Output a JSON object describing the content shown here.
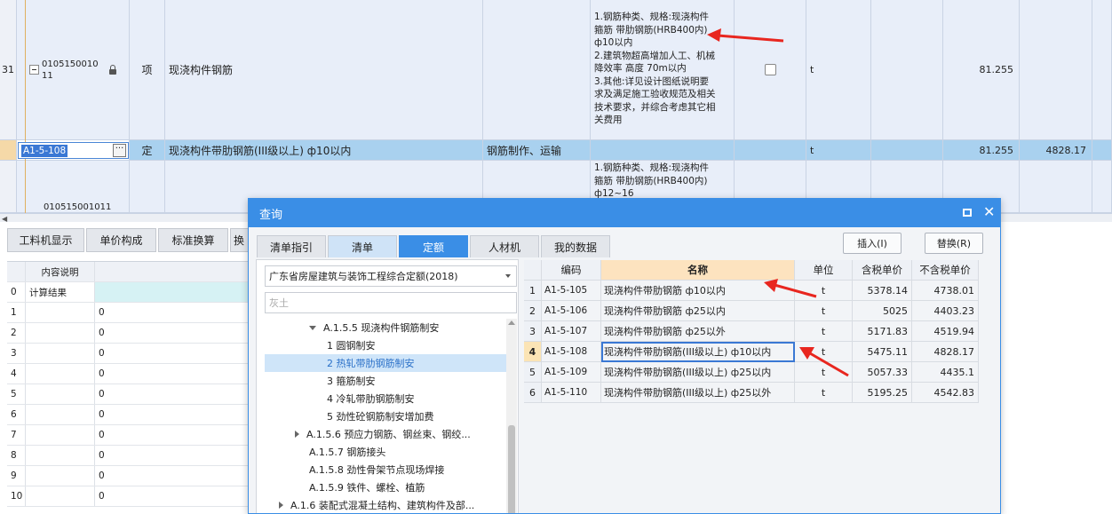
{
  "top_grid": {
    "row31": {
      "index": "31",
      "code": "010515001011",
      "type": "项",
      "name": "现浇构件钢筋",
      "features": "1.钢筋种类、规格:现浇构件\n箍筋 带肋钢筋(HRB400内)\nф10以内\n2.建筑物超高增加人工、机械\n降效率 高度 70m以内\n3.其他:详见设计图纸说明要\n求及满足施工验收规范及相关\n技术要求，并综合考虑其它相\n关费用",
      "unit": "t",
      "quantity": "81.255"
    },
    "row_sub": {
      "code": "A1-5-108",
      "type": "定",
      "name": "现浇构件带肋钢筋(III级以上) ф10以内",
      "work": "钢筋制作、运输",
      "unit": "t",
      "quantity": "81.255",
      "price": "4828.17"
    },
    "row_next": {
      "code": "010515001011",
      "features": "1.钢筋种类、规格:现浇构件\n箍筋 带肋钢筋(HRB400内)\nф12~16"
    }
  },
  "bottom_tabs": [
    "工料机显示",
    "单价构成",
    "标准换算",
    "换"
  ],
  "bottom_grid": {
    "header": "内容说明",
    "rows": [
      {
        "n": "0",
        "label": "计算结果",
        "value": ""
      },
      {
        "n": "1",
        "label": "",
        "value": "0"
      },
      {
        "n": "2",
        "label": "",
        "value": "0"
      },
      {
        "n": "3",
        "label": "",
        "value": "0"
      },
      {
        "n": "4",
        "label": "",
        "value": "0"
      },
      {
        "n": "5",
        "label": "",
        "value": "0"
      },
      {
        "n": "6",
        "label": "",
        "value": "0"
      },
      {
        "n": "7",
        "label": "",
        "value": "0"
      },
      {
        "n": "8",
        "label": "",
        "value": "0"
      },
      {
        "n": "9",
        "label": "",
        "value": "0"
      },
      {
        "n": "10",
        "label": "",
        "value": "0"
      }
    ]
  },
  "dialog": {
    "title": "查询",
    "tabs": [
      "清单指引",
      "清单",
      "定额",
      "人材机",
      "我的数据"
    ],
    "active_tab": "定额",
    "insert_label": "插入(I)",
    "replace_label": "替换(R)",
    "quota_library": "广东省房屋建筑与装饰工程综合定额(2018)",
    "search_placeholder": "灰土",
    "tree": [
      {
        "label": "A.1.5.5 现浇构件钢筋制安",
        "expanded": true
      },
      {
        "label": "1 圆钢制安"
      },
      {
        "label": "2 热轧带肋钢筋制安",
        "selected": true
      },
      {
        "label": "3 箍筋制安"
      },
      {
        "label": "4 冷轧带肋钢筋制安"
      },
      {
        "label": "5 劲性砼钢筋制安增加费"
      },
      {
        "label": "A.1.5.6 预应力钢筋、钢丝束、钢绞...",
        "expanded": false
      },
      {
        "label": "A.1.5.7 钢筋接头"
      },
      {
        "label": "A.1.5.8 劲性骨架节点现场焊接"
      },
      {
        "label": "A.1.5.9 铁件、螺栓、植筋"
      },
      {
        "label": "A.1.6 装配式混凝土结构、建筑构件及部...",
        "expanded": false
      }
    ],
    "table": {
      "headers": [
        "",
        "编码",
        "名称",
        "单位",
        "含税单价",
        "不含税单价"
      ],
      "rows": [
        {
          "n": "1",
          "code": "A1-5-105",
          "name": "现浇构件带肋钢筋 ф10以内",
          "unit": "t",
          "tax_price": "5378.14",
          "notax_price": "4738.01"
        },
        {
          "n": "2",
          "code": "A1-5-106",
          "name": "现浇构件带肋钢筋 ф25以内",
          "unit": "t",
          "tax_price": "5025",
          "notax_price": "4403.23"
        },
        {
          "n": "3",
          "code": "A1-5-107",
          "name": "现浇构件带肋钢筋 ф25以外",
          "unit": "t",
          "tax_price": "5171.83",
          "notax_price": "4519.94"
        },
        {
          "n": "4",
          "code": "A1-5-108",
          "name": "现浇构件带肋钢筋(III级以上) ф10以内",
          "unit": "t",
          "tax_price": "5475.11",
          "notax_price": "4828.17"
        },
        {
          "n": "5",
          "code": "A1-5-109",
          "name": "现浇构件带肋钢筋(III级以上) ф25以内",
          "unit": "t",
          "tax_price": "5057.33",
          "notax_price": "4435.1"
        },
        {
          "n": "6",
          "code": "A1-5-110",
          "name": "现浇构件带肋钢筋(III级以上) ф25以外",
          "unit": "t",
          "tax_price": "5195.25",
          "notax_price": "4542.83"
        }
      ]
    }
  },
  "colors": {
    "accent": "#3a8ee6",
    "selected_row": "#a9d1ef",
    "annotation_arrow": "#e8261f"
  }
}
